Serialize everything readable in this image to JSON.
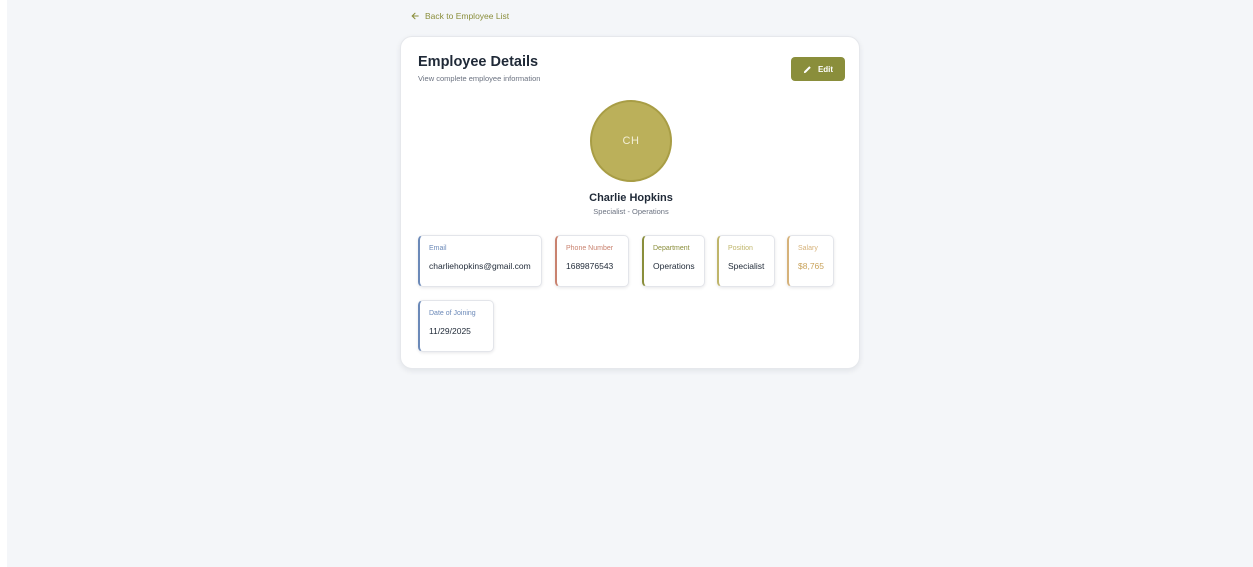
{
  "nav": {
    "back_label": "Back to Employee List"
  },
  "card": {
    "title": "Employee Details",
    "subtitle": "View complete employee information",
    "edit_label": "Edit"
  },
  "employee": {
    "initials": "CH",
    "name": "Charlie Hopkins",
    "role_line": "Specialist - Operations"
  },
  "fields": {
    "email": {
      "label": "Email",
      "value": "charliehopkins@gmail.com"
    },
    "phone": {
      "label": "Phone Number",
      "value": "1689876543"
    },
    "department": {
      "label": "Department",
      "value": "Operations"
    },
    "position": {
      "label": "Position",
      "value": "Specialist"
    },
    "salary": {
      "label": "Salary",
      "value": "$8,765"
    },
    "date_of_joining": {
      "label": "Date of Joining",
      "value": "11/29/2025"
    }
  },
  "colors": {
    "accent": "#8a8e3b",
    "avatar_bg": "#bbb05a",
    "email_accent": "#6b89b8",
    "phone_accent": "#c9826f",
    "department_accent": "#8a8e3b",
    "position_accent": "#bfb56a",
    "salary_accent": "#d6b27a",
    "page_background": "#f4f6f9"
  },
  "icons": {
    "back": "arrow-left-icon",
    "edit": "pencil-icon"
  }
}
